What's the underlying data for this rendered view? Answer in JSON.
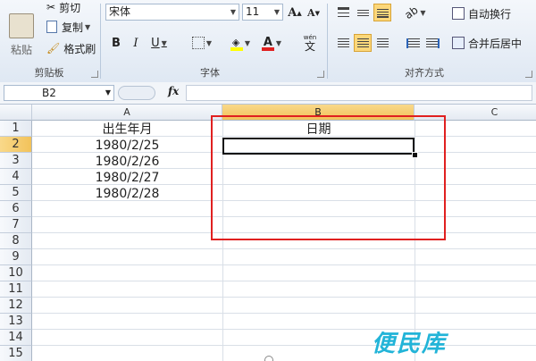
{
  "ribbon": {
    "clipboard": {
      "paste_label": "粘贴",
      "cut_label": "剪切",
      "copy_label": "复制",
      "format_painter_label": "格式刷",
      "group_label": "剪贴板"
    },
    "font": {
      "font_name": "宋体",
      "font_size": "11",
      "group_label": "字体",
      "bold": "B",
      "italic": "I",
      "underline": "U",
      "grow_font": "A",
      "shrink_font": "A",
      "font_color": "A",
      "phonetic": "wén"
    },
    "alignment": {
      "wrap_text_label": "自动换行",
      "merge_center_label": "合并后居中",
      "group_label": "对齐方式"
    }
  },
  "formula_bar": {
    "name_box": "B2",
    "fx": "fx",
    "content": ""
  },
  "sheet": {
    "columns": [
      "A",
      "B",
      "C"
    ],
    "rows": [
      "1",
      "2",
      "3",
      "4",
      "5",
      "6",
      "7",
      "8",
      "9",
      "10",
      "11",
      "12",
      "13",
      "14",
      "15"
    ],
    "cells": {
      "A1": "出生年月",
      "B1": "日期",
      "A2": "1980/2/25",
      "A3": "1980/2/26",
      "A4": "1980/2/27",
      "A5": "1980/2/28"
    },
    "selected_cell": "B2"
  },
  "colors": {
    "highlight": "#e02020",
    "accent": "#f2c25a",
    "watermark": "#22b4d8"
  },
  "watermark": "便民库"
}
